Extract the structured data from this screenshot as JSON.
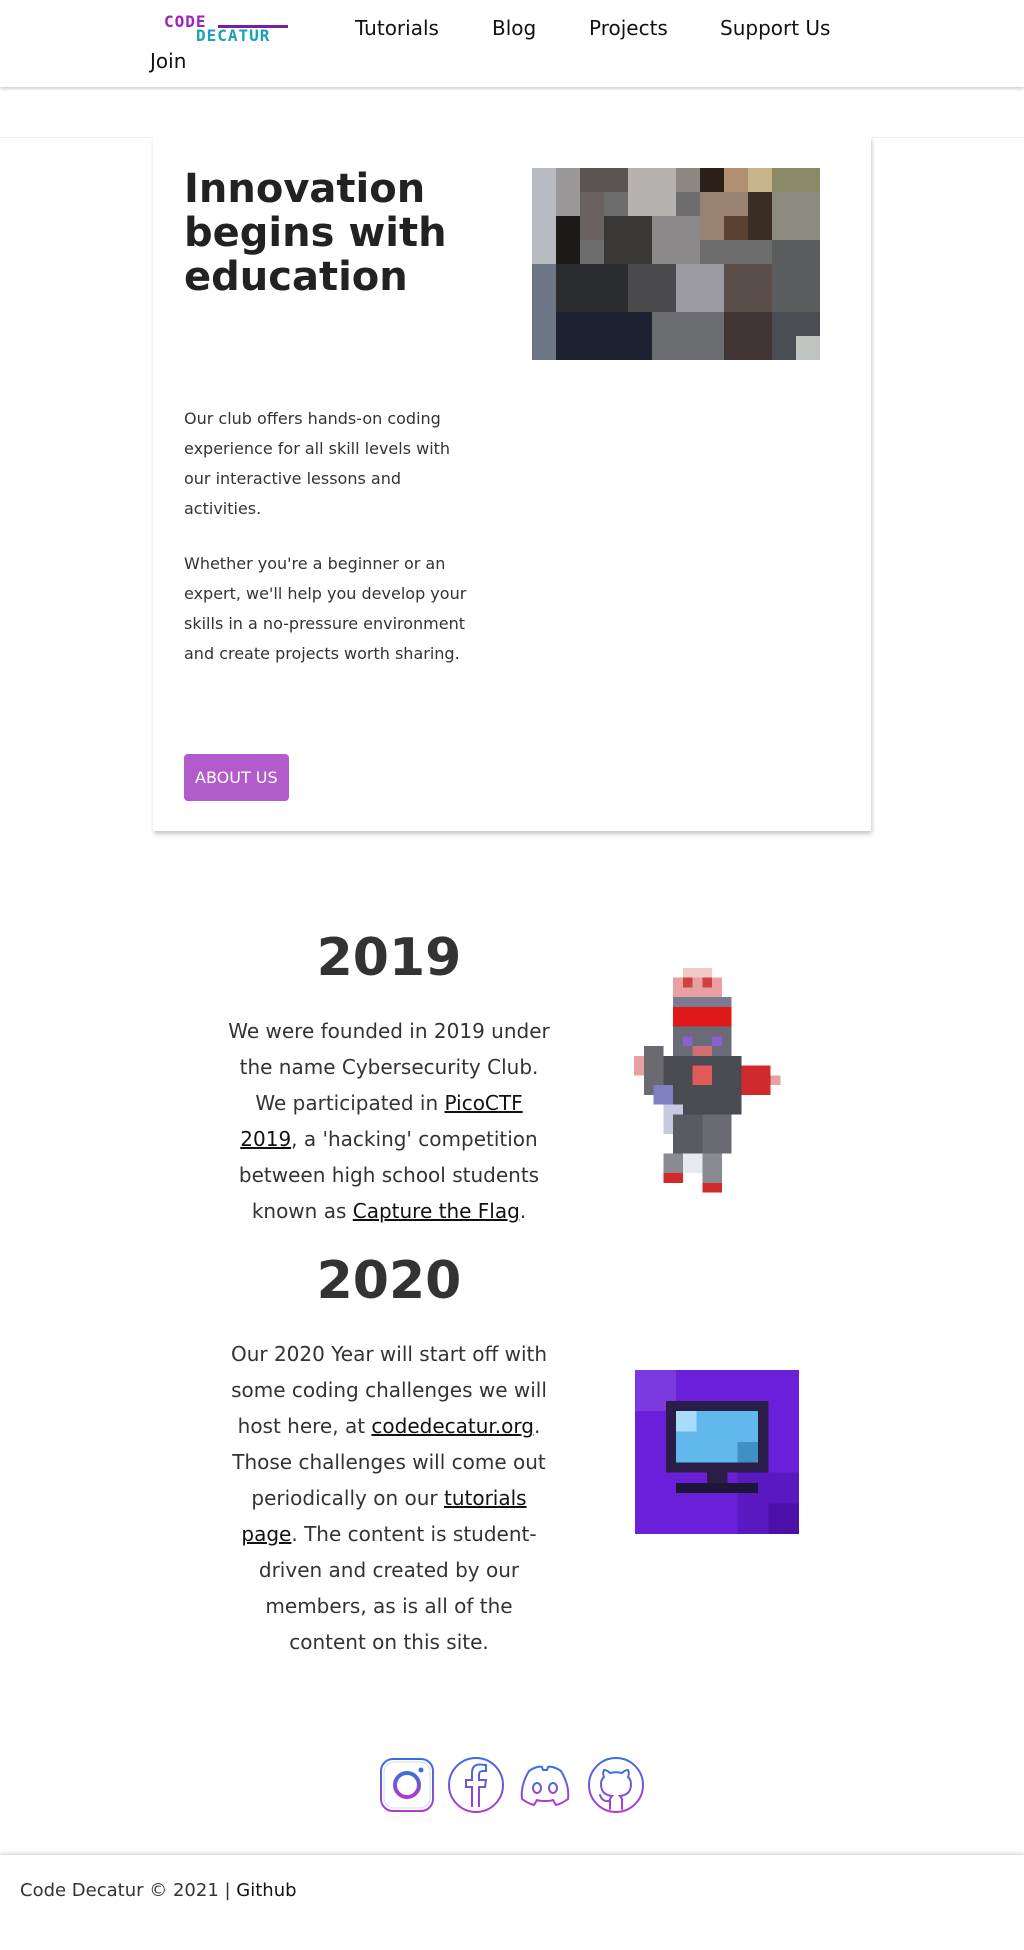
{
  "nav": {
    "logo_top": "CODE",
    "logo_bottom": "DECATUR",
    "links": [
      "Tutorials",
      "Blog",
      "Projects",
      "Support Us",
      "Join"
    ]
  },
  "hero": {
    "title": "Innovation begins with education",
    "paragraph1": "Our club offers hands-on coding experience for all skill levels with our interactive lessons and activities.",
    "paragraph2": "Whether you're a beginner or an expert, we'll help you develop your skills in a no-pressure environment and create projects worth sharing.",
    "button": "ABOUT US"
  },
  "history": [
    {
      "year": "2019",
      "text_before_link1": "We were founded in 2019 under the name Cybersecurity Club. We participated in ",
      "link1": "PicoCTF 2019",
      "text_between": ", a 'hacking' competition between high school students known as ",
      "link2": "Capture the Flag",
      "text_after": "."
    },
    {
      "year": "2020",
      "text_before_link1": "Our 2020 Year will start off with some coding challenges we will host here, at ",
      "link1": "codedecatur.org",
      "text_between": ". Those challenges will come out periodically on our ",
      "link2": "tutorials page",
      "text_after": ". The content is student-driven and created by our members, as is all of the content on this site."
    }
  ],
  "social_icons": [
    "instagram-icon",
    "facebook-icon",
    "discord-icon",
    "github-icon"
  ],
  "footer": {
    "copyright": "Code Decatur © 2021 | ",
    "link": "Github"
  },
  "colors": {
    "accent_button": "#b25ccc",
    "logo_purple": "#a020c0",
    "logo_teal": "#1aa0b8",
    "icon_gradient_start": "#3a6fe0",
    "icon_gradient_end": "#b03ad0"
  }
}
